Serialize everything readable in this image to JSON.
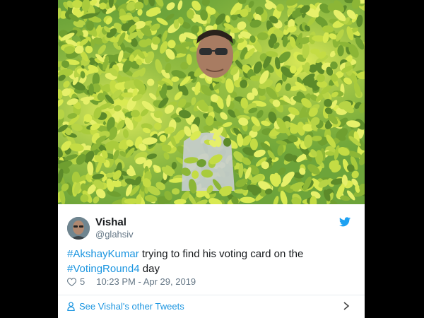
{
  "tweet": {
    "user_name": "Vishal",
    "user_handle": "@glahsiv",
    "text": {
      "hashtag1": "#AkshayKumar",
      "mid": " trying to find his voting card on the ",
      "hashtag2": "#VotingRound4",
      "end": " day"
    },
    "likes": "5",
    "timestamp": "10:23 PM - Apr 29, 2019",
    "footer_link": "See Vishal's other Tweets"
  },
  "icons": {
    "brand": "twitter-bird-icon",
    "like": "heart-icon",
    "profile": "person-icon",
    "navigate": "chevron-right-icon"
  },
  "colors": {
    "link": "#1b95e0",
    "text": "#14171a",
    "muted": "#657786",
    "background": "#000000",
    "leaf_yellow": "#d6e84a",
    "leaf_green": "#4f8f2a"
  }
}
